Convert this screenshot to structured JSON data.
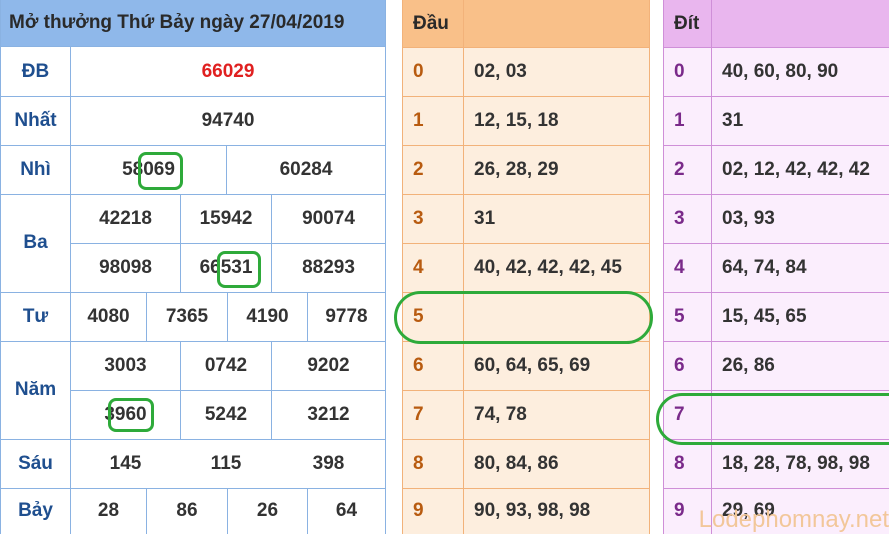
{
  "colors": {
    "results_header_bg": "#8fb8ea",
    "results_border": "#8ab2e2",
    "special_prize": "#e02020",
    "dau_header_bg": "#f9c089",
    "dau_body_bg": "#fdeede",
    "dau_border": "#f2b27a",
    "dau_number": "#b85b10",
    "dit_header_bg": "#e9b6ee",
    "dit_body_bg": "#fbeefd",
    "dit_border": "#cf8fd8",
    "dit_number": "#7a2a8a",
    "highlight": "#2eaa3a",
    "watermark": "#f2c79a"
  },
  "results": {
    "title": "Mở thưởng Thứ Bảy ngày 27/04/2019",
    "rows": [
      {
        "label": "ĐB",
        "values": [
          "66029"
        ]
      },
      {
        "label": "Nhất",
        "values": [
          "94740"
        ]
      },
      {
        "label": "Nhì",
        "values": [
          "58069",
          "60284"
        ]
      },
      {
        "label": "Ba",
        "values": [
          "42218",
          "15942",
          "90074",
          "98098",
          "66531",
          "88293"
        ]
      },
      {
        "label": "Tư",
        "values": [
          "4080",
          "7365",
          "4190",
          "9778"
        ]
      },
      {
        "label": "Năm",
        "values": [
          "3003",
          "0742",
          "9202",
          "3960",
          "5242",
          "3212"
        ]
      },
      {
        "label": "Sáu",
        "values": [
          "145",
          "115",
          "398"
        ]
      },
      {
        "label": "Bảy",
        "values": [
          "28",
          "86",
          "26",
          "64"
        ]
      }
    ]
  },
  "dau": {
    "header": "Đầu",
    "rows": [
      {
        "key": "0",
        "values": "02, 03"
      },
      {
        "key": "1",
        "values": "12, 15, 18"
      },
      {
        "key": "2",
        "values": "26, 28, 29"
      },
      {
        "key": "3",
        "values": "31"
      },
      {
        "key": "4",
        "values": "40, 42, 42, 42, 45"
      },
      {
        "key": "5",
        "values": ""
      },
      {
        "key": "6",
        "values": "60, 64, 65, 69"
      },
      {
        "key": "7",
        "values": "74, 78"
      },
      {
        "key": "8",
        "values": "80, 84, 86"
      },
      {
        "key": "9",
        "values": "90, 93, 98, 98"
      }
    ]
  },
  "dit": {
    "header": "Đít",
    "rows": [
      {
        "key": "0",
        "values": "40, 60, 80, 90"
      },
      {
        "key": "1",
        "values": "31"
      },
      {
        "key": "2",
        "values": "02, 12, 42, 42, 42"
      },
      {
        "key": "3",
        "values": "03, 93"
      },
      {
        "key": "4",
        "values": "64, 74, 84"
      },
      {
        "key": "5",
        "values": "15, 45, 65"
      },
      {
        "key": "6",
        "values": "26, 86"
      },
      {
        "key": "7",
        "values": ""
      },
      {
        "key": "8",
        "values": "18, 28, 78, 98, 98"
      },
      {
        "key": "9",
        "values": "29, 69"
      }
    ]
  },
  "watermark": "Lodephomnay.net"
}
